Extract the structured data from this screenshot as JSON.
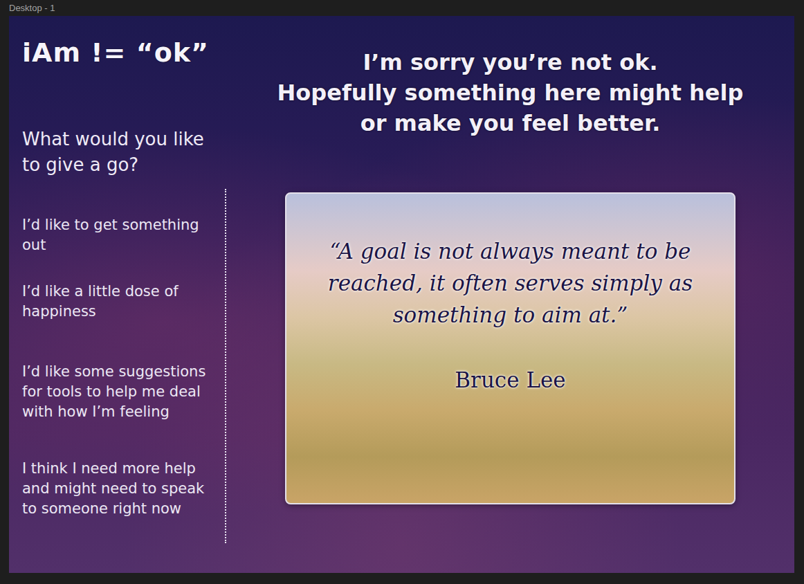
{
  "window": {
    "title": "Desktop - 1"
  },
  "logo": "iAm != “ok”",
  "prompt": "What would you like to give a go?",
  "options": [
    "I’d like to get something out",
    "I’d like a little dose of happiness",
    "I’d like some suggestions for tools to help me deal with how I’m feeling",
    "I think I need more help and might need to speak to someone right now"
  ],
  "heading": [
    "I’m sorry you’re not ok.",
    "Hopefully something here might help",
    "or make you feel better."
  ],
  "quote": {
    "lines": [
      "“A goal is not always meant to be",
      "reached, it often serves simply as",
      "something to aim at.”"
    ],
    "author": "Bruce Lee"
  }
}
